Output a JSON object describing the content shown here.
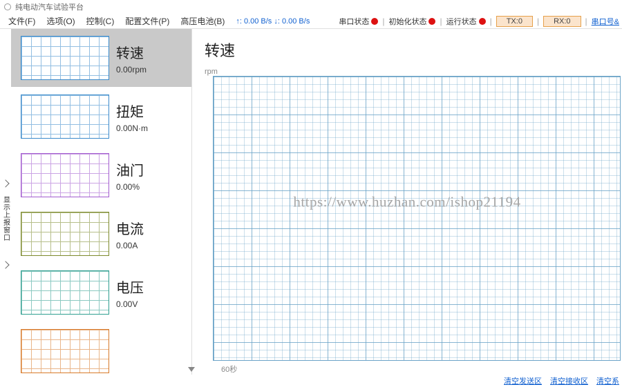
{
  "window": {
    "title": "纯电动汽车试验平台"
  },
  "menu": {
    "file": "文件(F)",
    "options": "选项(O)",
    "control": "控制(C)",
    "config": "配置文件(P)",
    "battery": "高压电池(B)"
  },
  "transfer": {
    "text": "↑: 0.00 B/s  ↓: 0.00 B/s"
  },
  "status": {
    "serial": "串口状态",
    "init": "初始化状态",
    "run": "运行状态",
    "tx_label": "TX:0",
    "rx_label": "RX:0",
    "port_link": "串口号&"
  },
  "rail": {
    "label": "显示上报窗口"
  },
  "params": [
    {
      "name": "转速",
      "value": "0.00rpm",
      "color": "c-blue",
      "selected": true
    },
    {
      "name": "扭矩",
      "value": "0.00N·m",
      "color": "c-blue",
      "selected": false
    },
    {
      "name": "油门",
      "value": "0.00%",
      "color": "c-purple",
      "selected": false
    },
    {
      "name": "电流",
      "value": "0.00A",
      "color": "c-olive",
      "selected": false
    },
    {
      "name": "电压",
      "value": "0.00V",
      "color": "c-teal",
      "selected": false
    },
    {
      "name": "",
      "value": "",
      "color": "c-orange",
      "selected": false
    }
  ],
  "main": {
    "title": "转速",
    "yunit": "rpm",
    "xunit": "60秒",
    "watermark": "https://www.huzhan.com/ishop21194"
  },
  "footer": {
    "clear_send": "清空发送区",
    "clear_recv": "清空接收区",
    "clear_all": "清空系"
  },
  "chart_data": {
    "type": "line",
    "title": "转速",
    "xlabel": "60秒",
    "ylabel": "rpm",
    "series": [
      {
        "name": "转速",
        "values": []
      }
    ],
    "xlim": [
      0,
      60
    ],
    "ylim": [
      0,
      1
    ]
  }
}
